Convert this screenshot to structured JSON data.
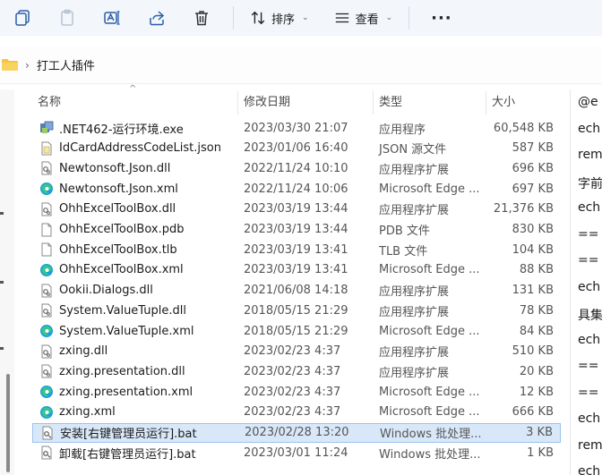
{
  "toolbar": {
    "icons": [
      "copy-icon",
      "paste-icon",
      "rename-icon",
      "share-icon",
      "delete-icon"
    ],
    "sort_label": "排序",
    "view_label": "查看",
    "more_label": "···"
  },
  "address": {
    "separator": "›",
    "crumb": "打工人插件"
  },
  "columns": {
    "name": "名称",
    "date": "修改日期",
    "type": "类型",
    "size": "大小"
  },
  "files": [
    {
      "name": ".NET462-运行环境.exe",
      "date": "2023/03/30 21:07",
      "type": "应用程序",
      "size": "60,548 KB",
      "icon": "exe-icon"
    },
    {
      "name": "IdCardAddressCodeList.json",
      "date": "2023/01/06 16:40",
      "type": "JSON 源文件",
      "size": "587 KB",
      "icon": "json-icon"
    },
    {
      "name": "Newtonsoft.Json.dll",
      "date": "2022/11/24 10:10",
      "type": "应用程序扩展",
      "size": "696 KB",
      "icon": "dll-icon"
    },
    {
      "name": "Newtonsoft.Json.xml",
      "date": "2022/11/24 10:06",
      "type": "Microsoft Edge ...",
      "size": "697 KB",
      "icon": "edge-icon"
    },
    {
      "name": "OhhExcelToolBox.dll",
      "date": "2023/03/19 13:44",
      "type": "应用程序扩展",
      "size": "21,376 KB",
      "icon": "dll-icon"
    },
    {
      "name": "OhhExcelToolBox.pdb",
      "date": "2023/03/19 13:44",
      "type": "PDB 文件",
      "size": "830 KB",
      "icon": "file-icon"
    },
    {
      "name": "OhhExcelToolBox.tlb",
      "date": "2023/03/19 13:41",
      "type": "TLB 文件",
      "size": "104 KB",
      "icon": "file-icon"
    },
    {
      "name": "OhhExcelToolBox.xml",
      "date": "2023/03/19 13:41",
      "type": "Microsoft Edge ...",
      "size": "88 KB",
      "icon": "edge-icon"
    },
    {
      "name": "Ookii.Dialogs.dll",
      "date": "2021/06/08 14:18",
      "type": "应用程序扩展",
      "size": "131 KB",
      "icon": "dll-icon"
    },
    {
      "name": "System.ValueTuple.dll",
      "date": "2018/05/15 21:29",
      "type": "应用程序扩展",
      "size": "78 KB",
      "icon": "dll-icon"
    },
    {
      "name": "System.ValueTuple.xml",
      "date": "2018/05/15 21:29",
      "type": "Microsoft Edge ...",
      "size": "84 KB",
      "icon": "edge-icon"
    },
    {
      "name": "zxing.dll",
      "date": "2023/02/23 4:37",
      "type": "应用程序扩展",
      "size": "510 KB",
      "icon": "dll-icon"
    },
    {
      "name": "zxing.presentation.dll",
      "date": "2023/02/23 4:37",
      "type": "应用程序扩展",
      "size": "20 KB",
      "icon": "dll-icon"
    },
    {
      "name": "zxing.presentation.xml",
      "date": "2023/02/23 4:37",
      "type": "Microsoft Edge ...",
      "size": "12 KB",
      "icon": "edge-icon"
    },
    {
      "name": "zxing.xml",
      "date": "2023/02/23 4:37",
      "type": "Microsoft Edge ...",
      "size": "666 KB",
      "icon": "edge-icon"
    },
    {
      "name": "安装[右键管理员运行].bat",
      "date": "2023/02/28 13:20",
      "type": "Windows 批处理...",
      "size": "3 KB",
      "icon": "bat-icon",
      "selected": true
    },
    {
      "name": "卸载[右键管理员运行].bat",
      "date": "2023/03/01 11:24",
      "type": "Windows 批处理...",
      "size": "1 KB",
      "icon": "bat-icon"
    }
  ],
  "preview_lines": [
    "@e",
    "ech",
    "rem",
    "字前",
    "ech",
    "==",
    "==",
    "ech",
    "具集",
    "ech",
    "==",
    "==",
    "ech",
    "rem",
    "ech"
  ],
  "colors": {
    "selection": "#d9e8f9",
    "accent": "#0f6cbd",
    "folder": "#f4c542"
  }
}
